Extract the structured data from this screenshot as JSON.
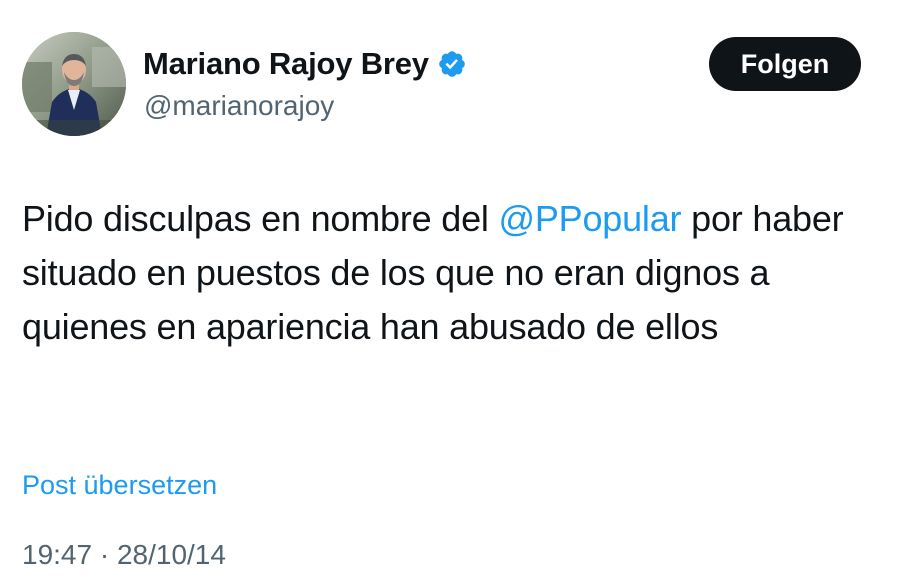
{
  "author": {
    "display_name": "Mariano Rajoy Brey",
    "handle": "@marianorajoy",
    "verified": true,
    "avatar_icon": "profile-photo"
  },
  "actions": {
    "follow_label": "Folgen"
  },
  "tweet": {
    "text_before": "Pido disculpas en nombre del ",
    "mention": "@PPopular",
    "text_after": " por haber situado en puestos de los que no eran dignos a quienes en apariencia han abusado de ellos",
    "translate_label": "Post übersetzen",
    "timestamp": "19:47 · 28/10/14"
  },
  "colors": {
    "text": "#0f1419",
    "secondary": "#536471",
    "link": "#1d9bf0",
    "button_bg": "#0f1419",
    "button_text": "#ffffff",
    "background": "#ffffff"
  }
}
